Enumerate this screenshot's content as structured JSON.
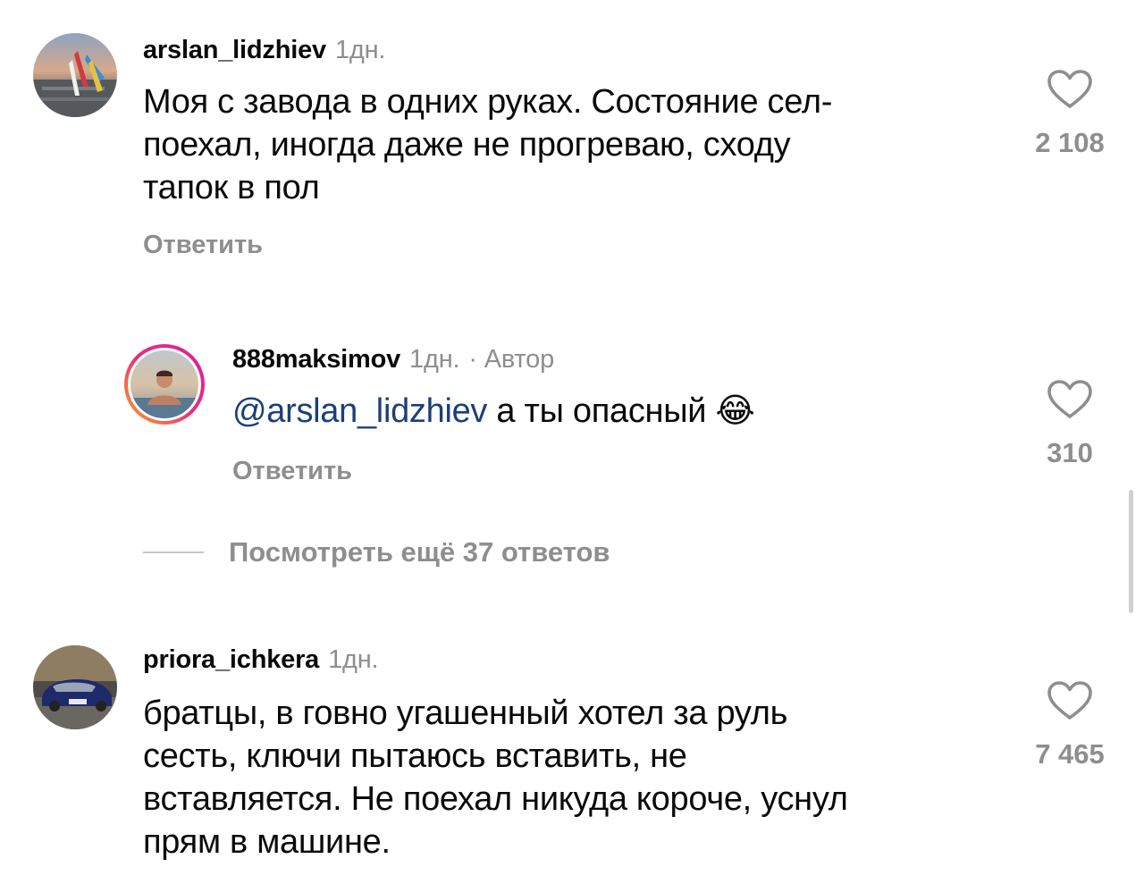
{
  "comments": [
    {
      "username": "arslan_lidzhiev",
      "time": "1дн.",
      "text": "Моя с завода в одних руках. Состояние сел-поехал, иногда даже не прогреваю, сходу тапок в пол",
      "text_lines": [
        "Моя с завода в одних руках. Состояние сел-",
        "поехал, иногда даже не прогреваю, сходу",
        "тапок в пол"
      ],
      "reply_label": "Ответить",
      "likes": "2 108",
      "avatar": "avatar-photo-sunset"
    },
    {
      "username": "888maksimov",
      "time": "1дн.",
      "author_badge": "· Автор",
      "mention": "@arslan_lidzhiev",
      "text": "а ты опасный",
      "emoji": "😂",
      "reply_label": "Ответить",
      "likes": "310",
      "avatar": "avatar-photo-pool-story-ring"
    },
    {
      "username": "priora_ichkera",
      "time": "1дн.",
      "text": "братцы, в говно угашенный хотел за руль сесть, ключи пытаюсь вставить, не вставляется. Не поехал никуда короче, уснул прям в машине.",
      "text_lines": [
        "братцы, в говно угашенный хотел за руль",
        "сесть, ключи пытаюсь вставить, не",
        "вставляется. Не поехал никуда короче, уснул",
        "прям в машине."
      ],
      "likes": "7 465",
      "avatar": "avatar-photo-car"
    }
  ],
  "view_more_replies": "Посмотреть ещё 37 ответов",
  "colors": {
    "text": "#0a0a0a",
    "secondary": "#8e8e8e",
    "mention": "#1b3f7a",
    "story_ring_start": "#f9a825",
    "story_ring_end": "#d6249f"
  },
  "icons": {
    "like": "heart-outline-icon"
  }
}
